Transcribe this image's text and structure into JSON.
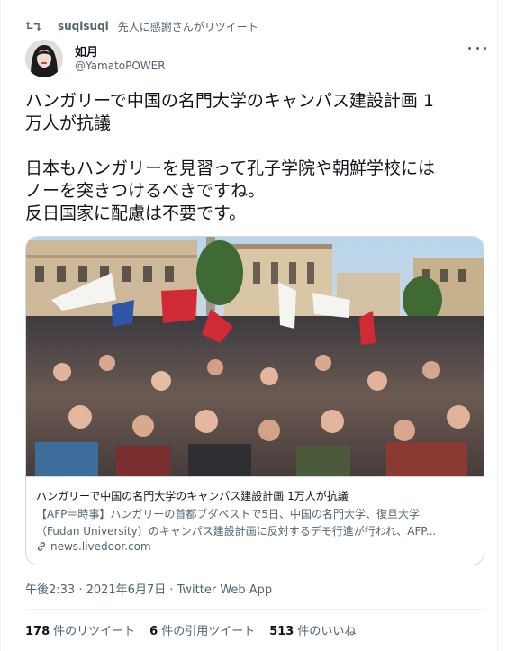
{
  "retweet_banner": {
    "user": "suqisuqi",
    "text": "先人に感謝さんがリツイート"
  },
  "author": {
    "name": "如月",
    "handle": "@YamatoPOWER"
  },
  "tweet": {
    "text": "ハンガリーで中国の名門大学のキャンパス建設計画 1\n万人が抗議\n\n日本もハンガリーを見習って孔子学院や朝鮮学校には\nノーを突きつけるべきですね。\n反日国家に配慮は不要です。"
  },
  "card": {
    "title": "ハンガリーで中国の名門大学のキャンパス建設計画 1万人が抗議",
    "desc_line1": "【AFP＝時事】ハンガリーの首都ブダペストで5日、中国の名門大学、復旦大学",
    "desc_line2": "（Fudan University）のキャンパス建設計画に反対するデモ行進が行われ、AFP...",
    "domain": "news.livedoor.com"
  },
  "meta": {
    "timestamp": "午後2:33 · 2021年6月7日 · Twitter Web App"
  },
  "stats": {
    "retweets_count": "178",
    "retweets_label": "件のリツイート",
    "quotes_count": "6",
    "quotes_label": "件の引用ツイート",
    "likes_count": "513",
    "likes_label": "件のいいね"
  },
  "icons": {
    "retweet": "retweet-icon",
    "more": "more-icon",
    "link": "link-icon"
  },
  "colors": {
    "text": "#0f1419",
    "secondary": "#536471",
    "border": "#cfd9de"
  }
}
